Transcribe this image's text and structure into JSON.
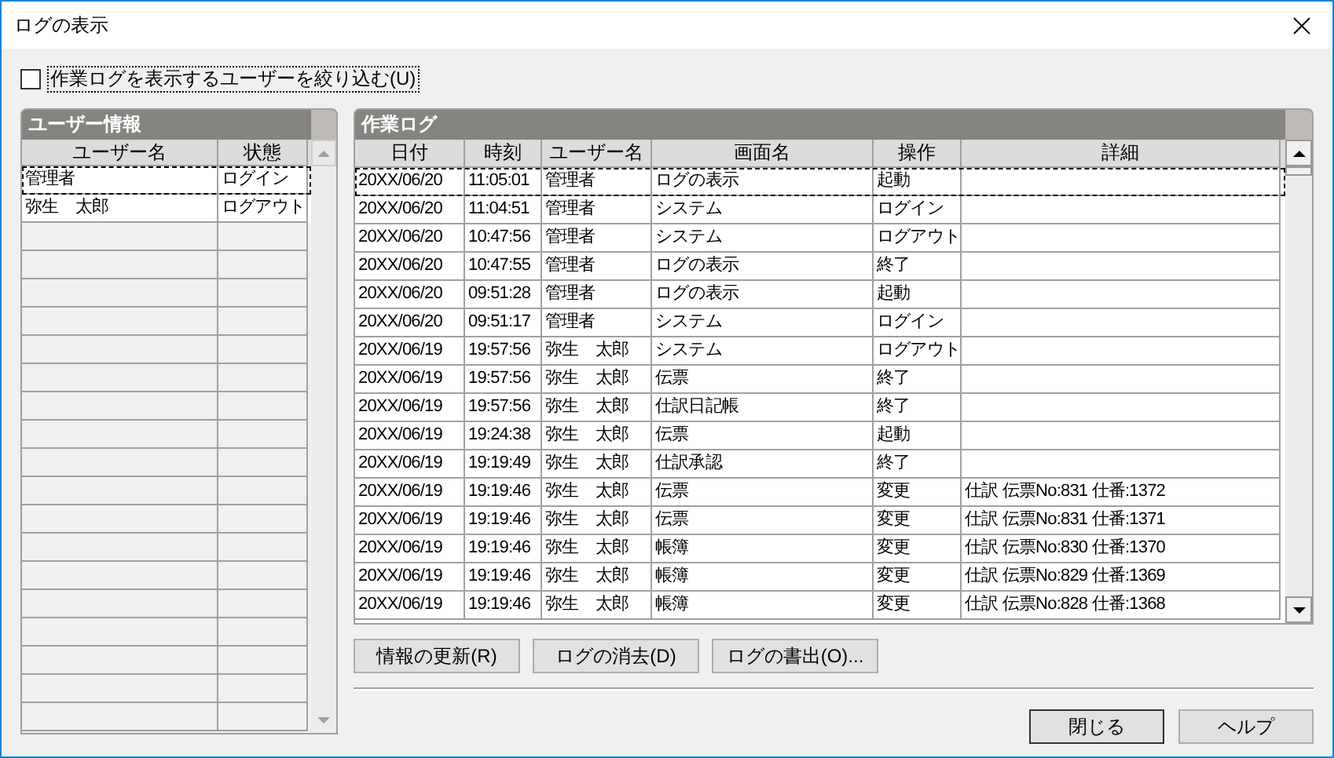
{
  "window": {
    "title": "ログの表示"
  },
  "filter_checkbox": {
    "label": "作業ログを表示するユーザーを絞り込む(U)",
    "checked": false
  },
  "user_panel": {
    "title": "ユーザー情報",
    "columns": [
      "ユーザー名",
      "状態"
    ],
    "rows": [
      {
        "cells": [
          "管理者",
          "ログイン"
        ],
        "selected": true
      },
      {
        "cells": [
          "弥生　太郎",
          "ログアウト"
        ],
        "selected": false
      }
    ]
  },
  "log_panel": {
    "title": "作業ログ",
    "columns": [
      "日付",
      "時刻",
      "ユーザー名",
      "画面名",
      "操作",
      "詳細"
    ],
    "rows": [
      {
        "cells": [
          "20XX/06/20",
          "11:05:01",
          "管理者",
          "ログの表示",
          "起動",
          ""
        ],
        "selected": true
      },
      {
        "cells": [
          "20XX/06/20",
          "11:04:51",
          "管理者",
          "システム",
          "ログイン",
          ""
        ],
        "selected": false
      },
      {
        "cells": [
          "20XX/06/20",
          "10:47:56",
          "管理者",
          "システム",
          "ログアウト",
          ""
        ],
        "selected": false
      },
      {
        "cells": [
          "20XX/06/20",
          "10:47:55",
          "管理者",
          "ログの表示",
          "終了",
          ""
        ],
        "selected": false
      },
      {
        "cells": [
          "20XX/06/20",
          "09:51:28",
          "管理者",
          "ログの表示",
          "起動",
          ""
        ],
        "selected": false
      },
      {
        "cells": [
          "20XX/06/20",
          "09:51:17",
          "管理者",
          "システム",
          "ログイン",
          ""
        ],
        "selected": false
      },
      {
        "cells": [
          "20XX/06/19",
          "19:57:56",
          "弥生　太郎",
          "システム",
          "ログアウト",
          ""
        ],
        "selected": false
      },
      {
        "cells": [
          "20XX/06/19",
          "19:57:56",
          "弥生　太郎",
          "伝票",
          "終了",
          ""
        ],
        "selected": false
      },
      {
        "cells": [
          "20XX/06/19",
          "19:57:56",
          "弥生　太郎",
          "仕訳日記帳",
          "終了",
          ""
        ],
        "selected": false
      },
      {
        "cells": [
          "20XX/06/19",
          "19:24:38",
          "弥生　太郎",
          "伝票",
          "起動",
          ""
        ],
        "selected": false
      },
      {
        "cells": [
          "20XX/06/19",
          "19:19:49",
          "弥生　太郎",
          "仕訳承認",
          "終了",
          ""
        ],
        "selected": false
      },
      {
        "cells": [
          "20XX/06/19",
          "19:19:46",
          "弥生　太郎",
          "伝票",
          "変更",
          "仕訳 伝票No:831 仕番:1372"
        ],
        "selected": false
      },
      {
        "cells": [
          "20XX/06/19",
          "19:19:46",
          "弥生　太郎",
          "伝票",
          "変更",
          "仕訳 伝票No:831 仕番:1371"
        ],
        "selected": false
      },
      {
        "cells": [
          "20XX/06/19",
          "19:19:46",
          "弥生　太郎",
          "帳簿",
          "変更",
          "仕訳 伝票No:830 仕番:1370"
        ],
        "selected": false
      },
      {
        "cells": [
          "20XX/06/19",
          "19:19:46",
          "弥生　太郎",
          "帳簿",
          "変更",
          "仕訳 伝票No:829 仕番:1369"
        ],
        "selected": false
      },
      {
        "cells": [
          "20XX/06/19",
          "19:19:46",
          "弥生　太郎",
          "帳簿",
          "変更",
          "仕訳 伝票No:828 仕番:1368"
        ],
        "selected": false
      }
    ]
  },
  "log_buttons": [
    "情報の更新(R)",
    "ログの消去(D)",
    "ログの書出(O)..."
  ],
  "dialog_buttons": [
    "閉じる",
    "ヘルプ"
  ]
}
